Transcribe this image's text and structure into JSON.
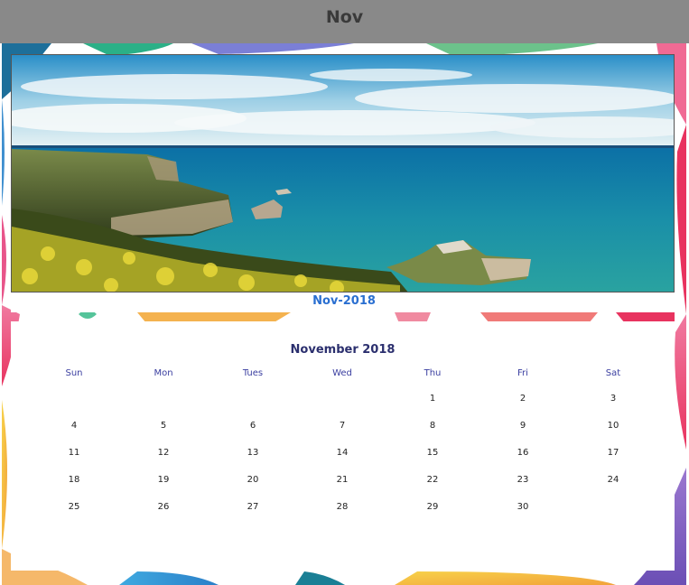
{
  "window": {
    "title": "Nov"
  },
  "photo": {
    "description_icon": "coastal-landscape-photo"
  },
  "caption": {
    "label": "Nov-2018"
  },
  "calendar": {
    "heading": "November 2018",
    "weekdays": [
      "Sun",
      "Mon",
      "Tues",
      "Wed",
      "Thu",
      "Fri",
      "Sat"
    ],
    "weeks": [
      [
        "",
        "",
        "",
        "",
        "1",
        "2",
        "3"
      ],
      [
        "4",
        "5",
        "6",
        "7",
        "8",
        "9",
        "10"
      ],
      [
        "11",
        "12",
        "13",
        "14",
        "15",
        "16",
        "17"
      ],
      [
        "18",
        "19",
        "20",
        "21",
        "22",
        "23",
        "24"
      ],
      [
        "25",
        "26",
        "27",
        "28",
        "29",
        "30",
        ""
      ]
    ]
  },
  "colors": {
    "title_bar": "#898989",
    "caption": "#2a6fd1",
    "heading": "#2b2f6e",
    "weekday": "#3a3ea0"
  }
}
